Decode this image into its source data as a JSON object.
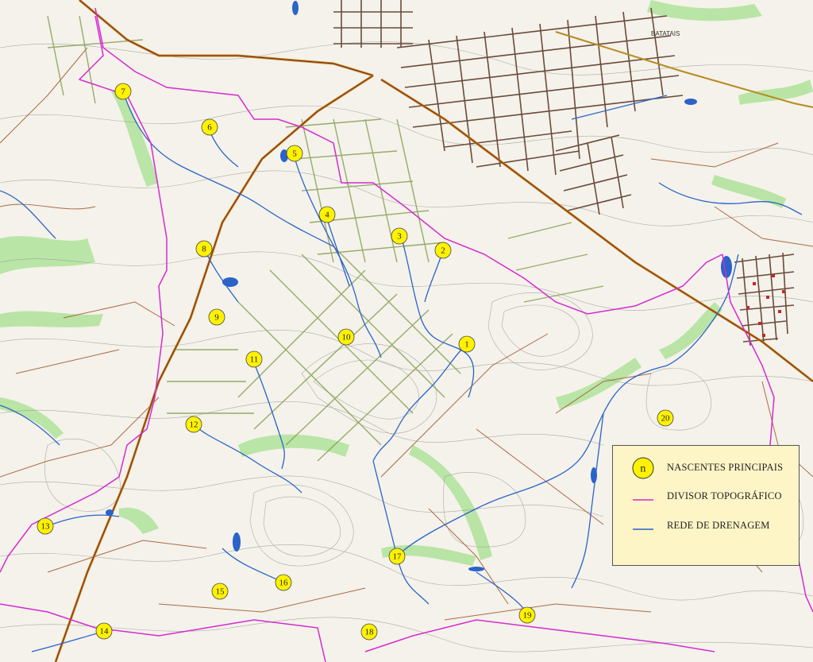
{
  "map": {
    "town_label": "BATATAIS",
    "colors": {
      "background": "#f4f2ea",
      "contour": "#8a8f86",
      "drainage": "#2b63c9",
      "divide": "#d62ad0",
      "road": "#a0522d",
      "highway": "#b88a1f",
      "vegetation": "#9fdc8a",
      "urban": "#6b4a3a",
      "spring_fill": "#fff200"
    }
  },
  "springs": [
    {
      "label": "1"
    },
    {
      "label": "2"
    },
    {
      "label": "3"
    },
    {
      "label": "4"
    },
    {
      "label": "5"
    },
    {
      "label": "6"
    },
    {
      "label": "7"
    },
    {
      "label": "8"
    },
    {
      "label": "9"
    },
    {
      "label": "10"
    },
    {
      "label": "11"
    },
    {
      "label": "12"
    },
    {
      "label": "13"
    },
    {
      "label": "14"
    },
    {
      "label": "15"
    },
    {
      "label": "16"
    },
    {
      "label": "17"
    },
    {
      "label": "18"
    },
    {
      "label": "19"
    },
    {
      "label": "20"
    }
  ],
  "legend": {
    "symbol_label": "n",
    "springs": "NASCENTES PRINCIPAIS",
    "divide": "DIVISOR TOPOGRÁFICO",
    "drainage": "REDE DE DRENAGEM"
  }
}
